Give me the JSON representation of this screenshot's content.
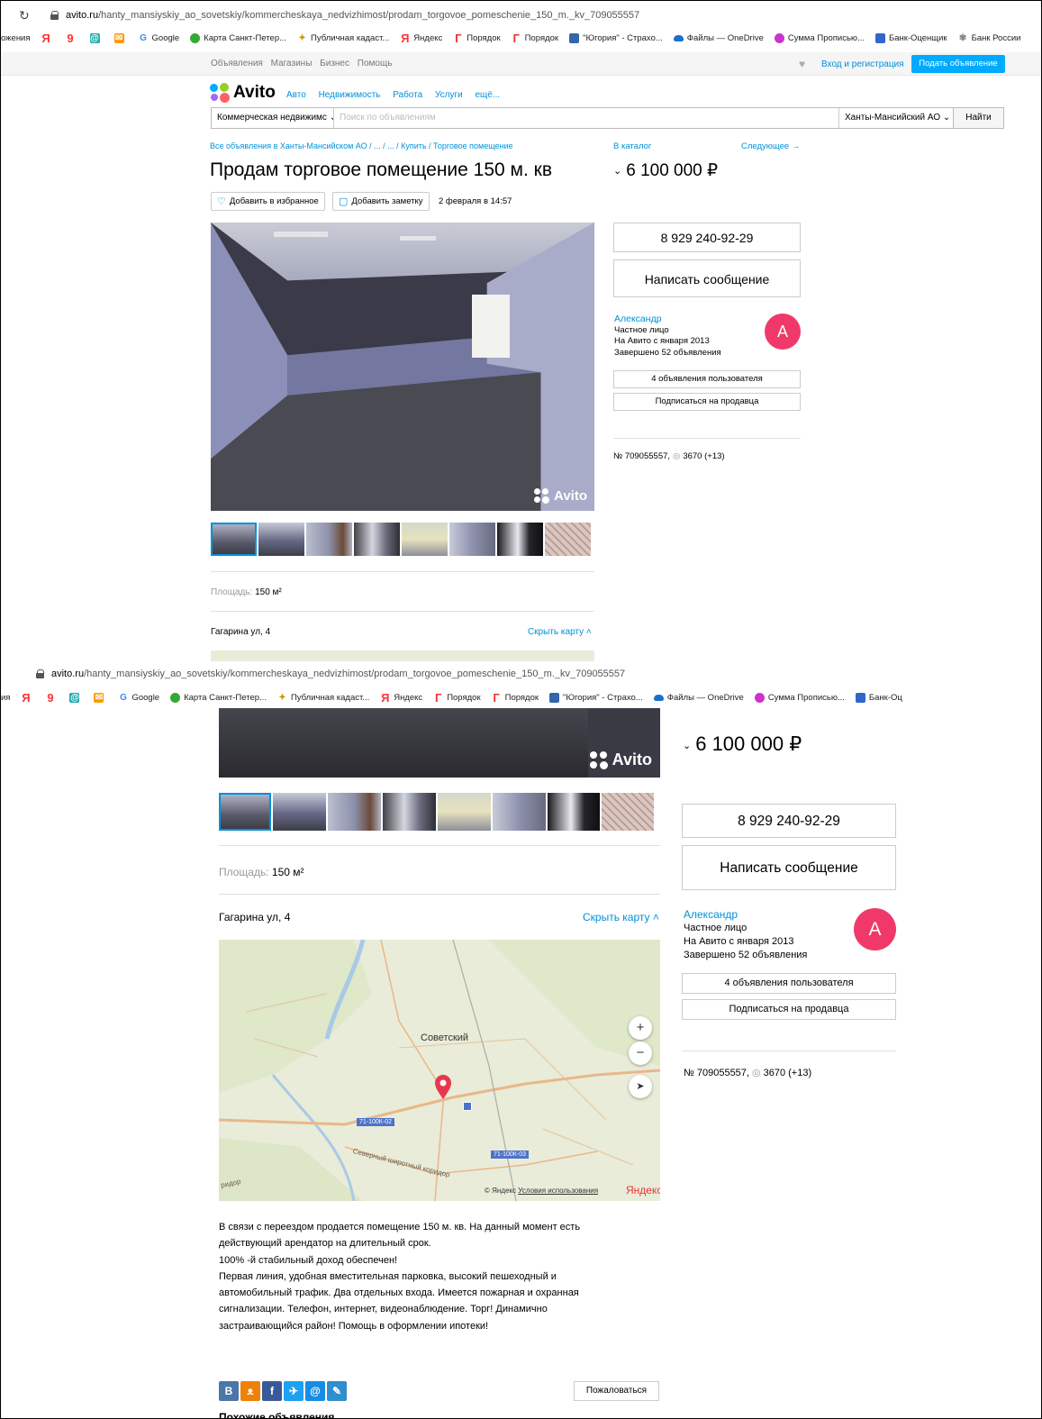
{
  "browser": {
    "url_host": "avito.ru",
    "url_path": "/hanty_mansiyskiy_ao_sovetskiy/kommercheskaya_nedvizhimost/prodam_torgovoe_pomeschenie_150_m._kv_709055557",
    "bookmarks_top": [
      "ожения",
      "Google",
      "Карта Санкт-Петер...",
      "Публичная кадаст...",
      "Яндекс",
      "Порядок",
      "Порядок",
      "\"Югория\" - Страхо...",
      "Файлы — OneDrive",
      "Сумма Прописью...",
      "Банк-Оценщик",
      "Банк России"
    ],
    "bookmarks_bottom": [
      "ия",
      "Google",
      "Карта Санкт-Петер...",
      "Публичная кадаст...",
      "Яндекс",
      "Порядок",
      "Порядок",
      "\"Югория\" - Страхо...",
      "Файлы — OneDrive",
      "Сумма Прописью...",
      "Банк-Оц"
    ]
  },
  "topnav": {
    "links": [
      "Объявления",
      "Магазины",
      "Бизнес",
      "Помощь"
    ],
    "login": "Вход и регистрация",
    "post_ad": "Подать объявление"
  },
  "logo": "Avito",
  "categories": [
    "Авто",
    "Недвижимость",
    "Работа",
    "Услуги",
    "ещё..."
  ],
  "search": {
    "category": "Коммерческая недвижимс",
    "placeholder": "Поиск по объявлениям",
    "region": "Ханты-Мансийский АО",
    "button": "Найти"
  },
  "breadcrumbs": "Все объявления в Ханты-Мансийском АО / ... / ... / Купить / Торговое помещение",
  "catalog_link": "В каталог",
  "next_link": "Следующее →",
  "listing": {
    "title": "Продам торговое помещение 150 м. кв",
    "price": "6 100 000 ₽",
    "add_favorite": "Добавить в избранное",
    "add_note": "Добавить заметку",
    "date": "2 февраля в 14:57",
    "watermark": "Avito",
    "area_label": "Площадь:",
    "area_value": "150 м²",
    "address": "Гагарина ул, 4",
    "hide_map": "Скрыть карту",
    "description": [
      "В связи с переездом продается помещение 150 м. кв. На данный момент есть",
      "действующий арендатор на длительный срок.",
      "100% -й стабильный доход обеспечен!",
      "Первая линия, удобная вместительная парковка, высокий пешеходный и",
      "автомобильный трафик. Два отдельных входа. Имеется пожарная и охранная",
      "сигнализации. Телефон, интернет, видеонаблюдение. Торг! Динамично",
      "застраивающийся район! Помощь в оформлении ипотеки!"
    ],
    "complain": "Пожаловаться",
    "similar": "Похожие объявления"
  },
  "seller": {
    "phone": "8 929 240-92-29",
    "write": "Написать сообщение",
    "name": "Александр",
    "type": "Частное лицо",
    "since": "На Авито с января 2013",
    "completed": "Завершено 52 объявления",
    "avatar_letter": "А",
    "user_ads": "4 объявления пользователя",
    "subscribe": "Подписаться на продавца",
    "ad_number": "№ 709055557,",
    "views": "3670 (+13)"
  },
  "map": {
    "city": "Советский",
    "road1": "71-100К-02",
    "road2": "71-100К-03",
    "corridor": "Северный широтный коридор",
    "corridor_left": "ридор",
    "zoom_in": "+",
    "zoom_out": "−",
    "copyright": "© Яндекс",
    "terms": "Условия использования",
    "brand": "Яндекс"
  },
  "social": [
    "В",
    "ok",
    "f",
    "tw",
    "@",
    "✎"
  ],
  "colors": {
    "link": "#0091d9",
    "accent_button": "#00aaff",
    "avatar": "#f0396a",
    "pin": "#e8384f",
    "map_bg": "#e9ecd8"
  }
}
